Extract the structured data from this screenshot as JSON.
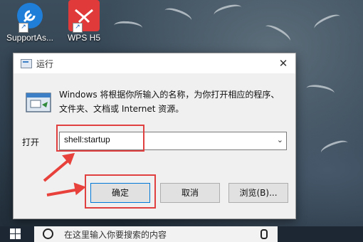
{
  "desktop": {
    "icons": [
      {
        "label": "SupportAs..."
      },
      {
        "label": "WPS H5"
      }
    ]
  },
  "dialog": {
    "title": "运行",
    "description_line1": "Windows 将根据你所输入的名称，为你打开相应的程序、",
    "description_line2": "文件夹、文档或 Internet 资源。",
    "open_label": "打开",
    "command_value": "shell:startup",
    "buttons": {
      "ok": "确定",
      "cancel": "取消",
      "browse": "浏览(B)..."
    },
    "close_glyph": "✕"
  },
  "taskbar": {
    "search_placeholder": "在这里输入你要搜索的内容"
  },
  "colors": {
    "highlight": "#e04040",
    "accent": "#0078d7"
  }
}
